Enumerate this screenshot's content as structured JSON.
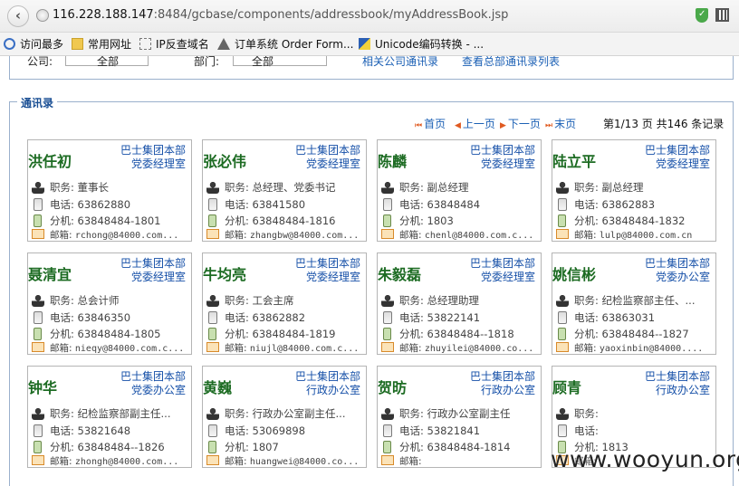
{
  "browser": {
    "back_icon": "arrow-left-icon",
    "url_host": "116.228.188.147",
    "url_rest": ":8484/gcbase/components/addressbook/myAddressBook.jsp"
  },
  "bookmarks": [
    {
      "label": "访问最多",
      "icon": "search-icon"
    },
    {
      "label": "常用网址",
      "icon": "folder-icon"
    },
    {
      "label": "IP反查域名",
      "icon": "page-icon"
    },
    {
      "label": "订单系统 Order Form...",
      "icon": "home-icon"
    },
    {
      "label": "Unicode编码转换 - ...",
      "icon": "unicode-icon"
    }
  ],
  "filter": {
    "company_label": "公司:",
    "company_value": "全部",
    "dept_label": "部门:",
    "dept_value": "全部",
    "link1": "相关公司通讯录",
    "link2": "查看总部通讯录列表"
  },
  "section": {
    "legend": "通讯录"
  },
  "pager": {
    "first": "首页",
    "prev": "上一页",
    "next": "下一页",
    "last": "末页",
    "info": "第1/13 页 共146 条记录"
  },
  "labels": {
    "title": "职务:",
    "phone": "电话:",
    "ext": "分机:",
    "email": "邮箱:"
  },
  "colors": {
    "name": "#1c6b22",
    "org": "#1650a8",
    "link": "#1a5fb4",
    "border": "#9ab0cc"
  },
  "contacts": [
    {
      "name": "洪任初",
      "org1": "巴士集团本部",
      "org2": "党委经理室",
      "title": "董事长",
      "phone": "63862880",
      "ext": "63848484-1801",
      "email": "rchong@84000.com..."
    },
    {
      "name": "张必伟",
      "org1": "巴士集团本部",
      "org2": "党委经理室",
      "title": "总经理、党委书记",
      "phone": "63841580",
      "ext": "63848484-1816",
      "email": "zhangbw@84000.com..."
    },
    {
      "name": "陈麟",
      "org1": "巴士集团本部",
      "org2": "党委经理室",
      "title": "副总经理",
      "phone": "63848484",
      "ext": "1803",
      "email": "chenl@84000.com.c..."
    },
    {
      "name": "陆立平",
      "org1": "巴士集团本部",
      "org2": "党委经理室",
      "title": "副总经理",
      "phone": "63862883",
      "ext": "63848484-1832",
      "email": "lulp@84000.com.cn"
    },
    {
      "name": "聂清宜",
      "org1": "巴士集团本部",
      "org2": "党委经理室",
      "title": "总会计师",
      "phone": "63846350",
      "ext": "63848484-1805",
      "email": "nieqy@84000.com.c..."
    },
    {
      "name": "牛均亮",
      "org1": "巴士集团本部",
      "org2": "党委经理室",
      "title": "工会主席",
      "phone": "63862882",
      "ext": "63848484-1819",
      "email": "niujl@84000.com.c..."
    },
    {
      "name": "朱毅磊",
      "org1": "巴士集团本部",
      "org2": "党委经理室",
      "title": "总经理助理",
      "phone": "53822141",
      "ext": "63848484--1818",
      "email": "zhuyilei@84000.co..."
    },
    {
      "name": "姚信彬",
      "org1": "巴士集团本部",
      "org2": "党委办公室",
      "title": "纪检监察部主任、...",
      "phone": "63863031",
      "ext": "63848484--1827",
      "email": "yaoxinbin@84000...."
    },
    {
      "name": "钟华",
      "org1": "巴士集团本部",
      "org2": "党委办公室",
      "title": "纪检监察部副主任...",
      "phone": "53821648",
      "ext": "63848484--1826",
      "email": "zhongh@84000.com..."
    },
    {
      "name": "黄巍",
      "org1": "巴士集团本部",
      "org2": "行政办公室",
      "title": "行政办公室副主任...",
      "phone": "53069898",
      "ext": "1807",
      "email": "huangwei@84000.co..."
    },
    {
      "name": "贺昉",
      "org1": "巴士集团本部",
      "org2": "行政办公室",
      "title": "行政办公室副主任",
      "phone": "53821841",
      "ext": "63848484-1814",
      "email": ""
    },
    {
      "name": "顾青",
      "org1": "巴士集团本部",
      "org2": "行政办公室",
      "title": "",
      "phone": "",
      "ext": "1813",
      "email": ""
    }
  ],
  "watermark": "www.wooyun.org"
}
